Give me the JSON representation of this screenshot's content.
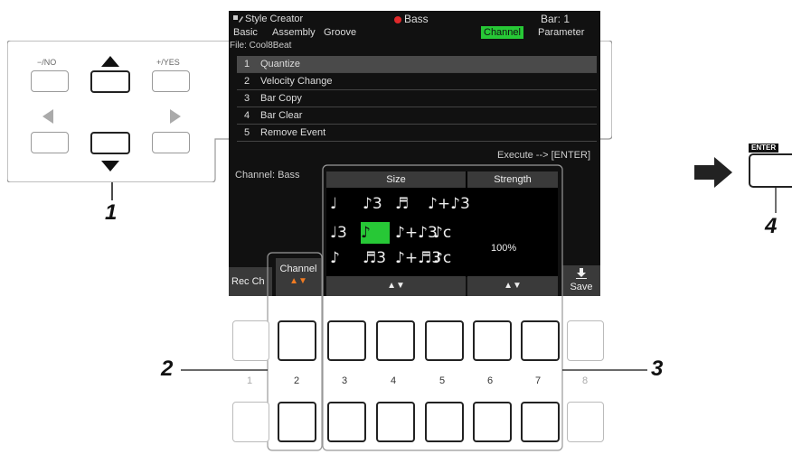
{
  "header": {
    "title": "Style Creator",
    "mode": "Bass",
    "bar": "Bar:   1",
    "tabs": [
      "Basic",
      "Assembly",
      "Groove",
      "Channel",
      "Parameter"
    ],
    "active_tab": "Channel",
    "accent_color": "#27c836",
    "rec_dot_color": "#e0292b"
  },
  "file_label": "File: Cool8Beat",
  "list": [
    {
      "num": "1",
      "label": "Quantize"
    },
    {
      "num": "2",
      "label": "Velocity Change"
    },
    {
      "num": "3",
      "label": "Bar Copy"
    },
    {
      "num": "4",
      "label": "Bar Clear"
    },
    {
      "num": "5",
      "label": "Remove Event"
    }
  ],
  "execute_label": "Execute --> [ENTER]",
  "channel_label": "Channel: Bass",
  "panel": {
    "size_header": "Size",
    "strength_header": "Strength",
    "strength_value": "100%",
    "notes": [
      [
        "♩",
        "♪3",
        "♬",
        "♪+♪3"
      ],
      [
        "♩3",
        "♪",
        "♪+♪3",
        "♪c"
      ],
      [
        "♪",
        "♬3",
        "♪+♬3",
        "♪c"
      ]
    ]
  },
  "bottom": {
    "rec_ch": "Rec Ch",
    "channel": "Channel",
    "channel_arrows": "▲▼",
    "size_arrows": "▲▼",
    "strength_arrows": "▲▼",
    "save": "Save",
    "save_icon": "download-icon"
  },
  "left_panel": {
    "no_label": "−/NO",
    "yes_label": "+/YES"
  },
  "enter_label": "ENTER",
  "button_numbers": [
    "1",
    "2",
    "3",
    "4",
    "5",
    "6",
    "7",
    "8"
  ],
  "callouts": [
    "1",
    "2",
    "3",
    "4"
  ]
}
